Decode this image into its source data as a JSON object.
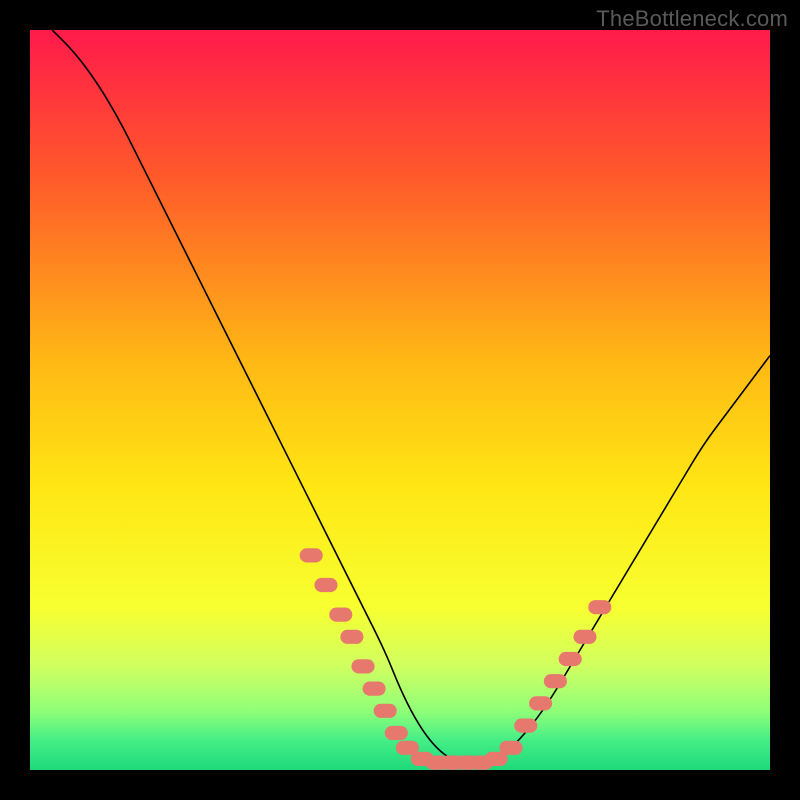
{
  "watermark": "TheBottleneck.com",
  "chart_data": {
    "type": "line",
    "title": "",
    "xlabel": "",
    "ylabel": "",
    "xlim": [
      0,
      100
    ],
    "ylim": [
      0,
      100
    ],
    "grid": false,
    "legend": false,
    "background_gradient": {
      "stops": [
        {
          "offset": 0.0,
          "color": "#ff1a4b"
        },
        {
          "offset": 0.2,
          "color": "#ff5a2a"
        },
        {
          "offset": 0.45,
          "color": "#ffb914"
        },
        {
          "offset": 0.62,
          "color": "#ffe714"
        },
        {
          "offset": 0.78,
          "color": "#f7ff30"
        },
        {
          "offset": 0.86,
          "color": "#d0ff60"
        },
        {
          "offset": 0.92,
          "color": "#90ff78"
        },
        {
          "offset": 0.96,
          "color": "#44ee86"
        },
        {
          "offset": 1.0,
          "color": "#1ed97a"
        }
      ]
    },
    "series": [
      {
        "name": "bottleneck-curve",
        "color": "#000000",
        "x": [
          3,
          6,
          9,
          12,
          15,
          18,
          21,
          24,
          27,
          30,
          33,
          36,
          39,
          42,
          45,
          48,
          50,
          52,
          54,
          56,
          58,
          60,
          62,
          64,
          67,
          70,
          73,
          76,
          79,
          82,
          85,
          88,
          91,
          94,
          97,
          100
        ],
        "y": [
          100,
          97,
          93,
          88,
          82,
          76,
          70,
          64,
          58,
          52,
          46,
          40,
          34,
          28,
          22,
          16,
          11,
          7,
          4,
          2,
          1,
          1,
          1,
          2,
          5,
          9,
          14,
          19,
          24,
          29,
          34,
          39,
          44,
          48,
          52,
          56
        ]
      }
    ],
    "markers": {
      "name": "highlight-dots",
      "color": "#e6786e",
      "radius": 1.2,
      "points": [
        {
          "x": 38,
          "y": 29
        },
        {
          "x": 40,
          "y": 25
        },
        {
          "x": 42,
          "y": 21
        },
        {
          "x": 43.5,
          "y": 18
        },
        {
          "x": 45,
          "y": 14
        },
        {
          "x": 46.5,
          "y": 11
        },
        {
          "x": 48,
          "y": 8
        },
        {
          "x": 49.5,
          "y": 5
        },
        {
          "x": 51,
          "y": 3
        },
        {
          "x": 53,
          "y": 1.5
        },
        {
          "x": 55,
          "y": 1
        },
        {
          "x": 57,
          "y": 1
        },
        {
          "x": 59,
          "y": 1
        },
        {
          "x": 61,
          "y": 1
        },
        {
          "x": 63,
          "y": 1.5
        },
        {
          "x": 65,
          "y": 3
        },
        {
          "x": 67,
          "y": 6
        },
        {
          "x": 69,
          "y": 9
        },
        {
          "x": 71,
          "y": 12
        },
        {
          "x": 73,
          "y": 15
        },
        {
          "x": 75,
          "y": 18
        },
        {
          "x": 77,
          "y": 22
        }
      ]
    }
  }
}
